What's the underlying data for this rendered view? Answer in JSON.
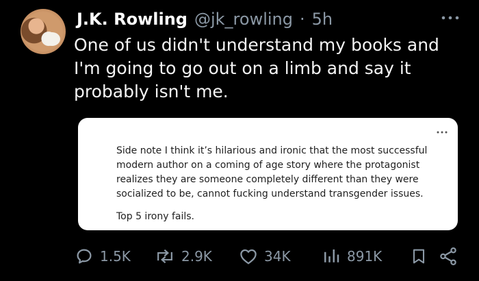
{
  "tweet": {
    "name": "J.K. Rowling",
    "handle": "@jk_rowling",
    "separator": "·",
    "time": "5h",
    "text": "One of us didn't understand my books and I'm going to go out on a limb and say it probably isn't me."
  },
  "quote": {
    "text": "Side note I think it’s hilarious and ironic that the most successful modern author on a coming of age story where the protagonist realizes they are someone completely different than they were socialized to be, cannot fucking understand transgender issues.",
    "footer": "Top 5 irony fails."
  },
  "actions": {
    "replies": "1.5K",
    "reposts": "2.9K",
    "likes": "34K",
    "views": "891K"
  },
  "icons": {
    "avatar": "profile-photo-with-dog",
    "more": "more-icon",
    "reply": "reply-icon",
    "repost": "repost-icon",
    "like": "heart-icon",
    "views": "analytics-icon",
    "bookmark": "bookmark-icon",
    "share": "share-icon"
  }
}
